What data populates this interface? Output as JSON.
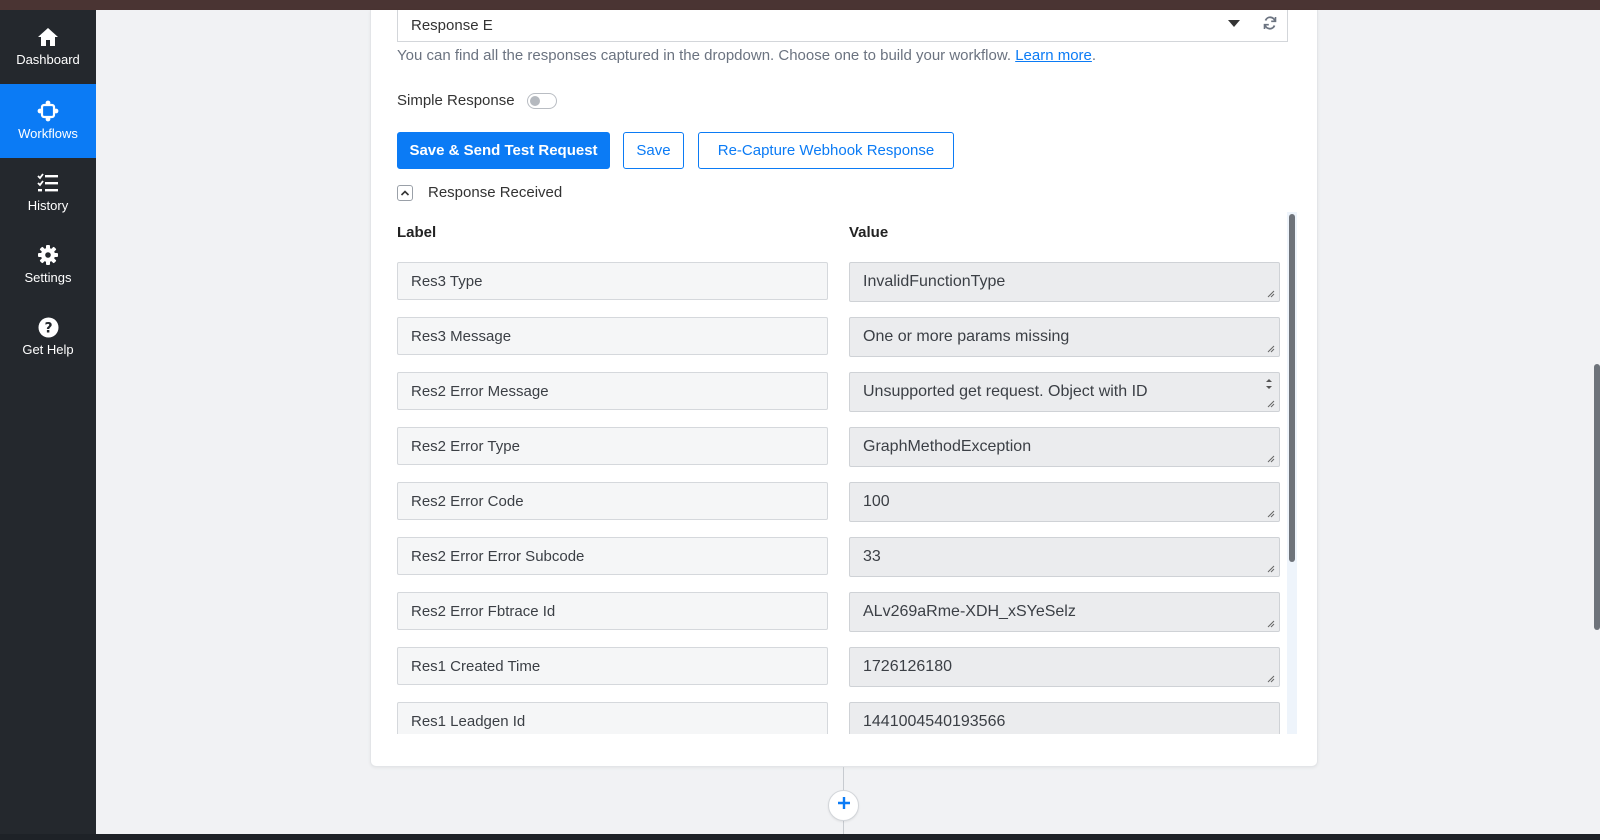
{
  "sidebar": {
    "items": [
      {
        "label": "Dashboard",
        "icon": "home-icon",
        "active": false
      },
      {
        "label": "Workflows",
        "icon": "workflow-icon",
        "active": true
      },
      {
        "label": "History",
        "icon": "history-list-icon",
        "active": false
      },
      {
        "label": "Settings",
        "icon": "gear-icon",
        "active": false
      },
      {
        "label": "Get Help",
        "icon": "help-icon",
        "active": false
      }
    ]
  },
  "response_select": {
    "selected": "Response E"
  },
  "helper": {
    "text": "You can find all the responses captured in the dropdown. Choose one to build your workflow.",
    "link": "Learn more",
    "suffix": "."
  },
  "simple_response": {
    "label": "Simple Response",
    "enabled": false
  },
  "buttons": {
    "save_send": "Save & Send Test Request",
    "save": "Save",
    "recapture": "Re-Capture Webhook Response"
  },
  "response_received": {
    "title": "Response Received",
    "col_label": "Label",
    "col_value": "Value",
    "rows": [
      {
        "label": "Res3 Type",
        "value": "InvalidFunctionType"
      },
      {
        "label": "Res3 Message",
        "value": "One or more params missing"
      },
      {
        "label": "Res2 Error Message",
        "value": "Unsupported get request. Object with ID"
      },
      {
        "label": "Res2 Error Type",
        "value": "GraphMethodException"
      },
      {
        "label": "Res2 Error Code",
        "value": "100"
      },
      {
        "label": "Res2 Error Error Subcode",
        "value": "33"
      },
      {
        "label": "Res2 Error Fbtrace Id",
        "value": "ALv269aRme-XDH_xSYeSelz"
      },
      {
        "label": "Res1 Created Time",
        "value": "1726126180"
      },
      {
        "label": "Res1 Leadgen Id",
        "value": "1441004540193566"
      }
    ]
  },
  "colors": {
    "accent": "#0b7bf5",
    "sidebar_bg": "#24282d",
    "canvas_bg": "#f1f2f4"
  }
}
